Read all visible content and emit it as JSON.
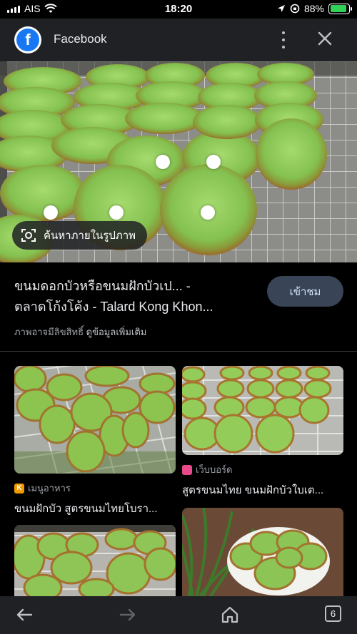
{
  "status_bar": {
    "carrier": "AIS",
    "time": "18:20",
    "battery": "88%",
    "battery_level": 0.88
  },
  "header": {
    "app_title": "Facebook",
    "icons": [
      "facebook-logo",
      "more-vert-icon",
      "close-icon"
    ]
  },
  "lens": {
    "chip_label": "ค้นหาภายในรูปภาพ"
  },
  "result": {
    "title_line1": "ขนมดอกบัวหรือขนมฝักบัวเป... -",
    "title_line2": "ตลาดโก้งโค้ง - Talard Kong Khon...",
    "visit_label": "เข้าชม",
    "copyright_note": "ภาพอาจมีลิขสิทธิ์",
    "more_info_link": "ดูข้อมูลเพิ่มเติม"
  },
  "related": [
    {
      "source": "เมนูอาหาร",
      "favicon_letter": "K",
      "favicon_color": "#f29900",
      "title": "ขนมฝักบัว สูตรขนมไทยโบรา..."
    },
    {
      "source": "เว็บบอร์ด",
      "favicon_letter": "",
      "favicon_color": "#e94b8a",
      "title": "สูตรขนมไทย ขนมฝักบัวใบเต..."
    },
    {
      "source": "",
      "favicon_letter": "",
      "favicon_color": "",
      "title": ""
    },
    {
      "source": "",
      "favicon_letter": "",
      "favicon_color": "",
      "title": ""
    }
  ],
  "bottom_nav": {
    "tab_count": "6",
    "icons": [
      "back-arrow-icon",
      "forward-arrow-icon",
      "home-icon",
      "tabs-icon"
    ]
  },
  "colors": {
    "background": "#202124",
    "accent_button": "#394457",
    "battery_green": "#31d158",
    "facebook_blue": "#1877f2"
  }
}
